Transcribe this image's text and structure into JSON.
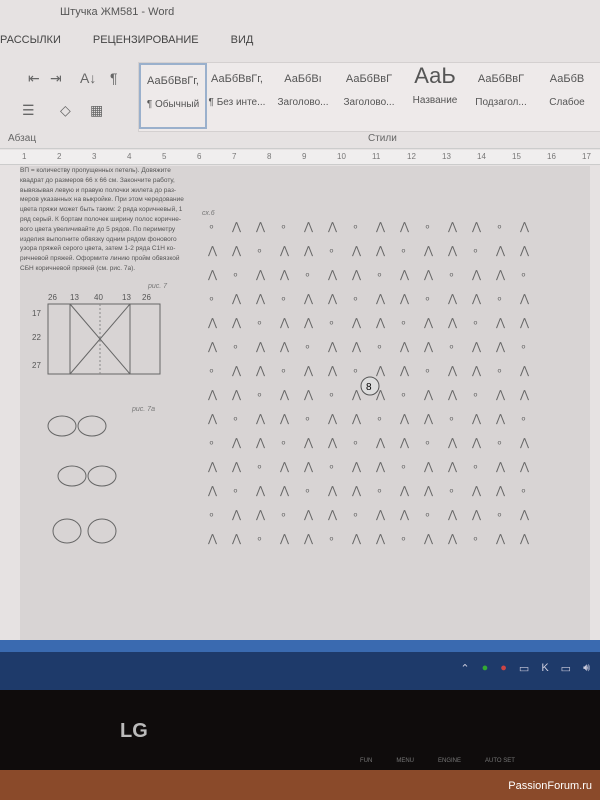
{
  "window": {
    "title": "Штучка ЖМ581 - Word"
  },
  "menu": [
    "РАССЫЛКИ",
    "РЕЦЕНЗИРОВАНИЕ",
    "ВИД"
  ],
  "styles": [
    {
      "sample": "АаБбВвГг,",
      "name": "¶ Обычный"
    },
    {
      "sample": "АаБбВвГг,",
      "name": "¶ Без инте..."
    },
    {
      "sample": "АаБбВı",
      "name": "Заголово..."
    },
    {
      "sample": "АаБбВвГ",
      "name": "Заголово..."
    },
    {
      "sample": "АаЬ",
      "name": "Название"
    },
    {
      "sample": "АаБбВвГ",
      "name": "Подзагол..."
    },
    {
      "sample": "АаБбВ",
      "name": "Слабое"
    }
  ],
  "groups": {
    "paragraph": "Абзац",
    "styles": "Стили"
  },
  "ruler": [
    "1",
    "2",
    "3",
    "4",
    "5",
    "6",
    "7",
    "8",
    "9",
    "10",
    "11",
    "12",
    "13",
    "14",
    "15",
    "16",
    "17"
  ],
  "document": {
    "paragraph": [
      "ВП = количеству пропущенных петель). Довяжите",
      "квадрат до размеров 66 х 66 см. Закончите работу,",
      "вывязывая левую и правую полочки жилета до раз-",
      "меров указанных на выкройке. При этом чередование",
      "цвета пряжи может быть таким: 2 ряда коричневый, 1",
      "ряд серый. К бортам полочек ширину полос коричне-",
      "вого цвета увеличивайте до 5 рядов. По периметру",
      "изделия выполните обвязку одним рядом фонового",
      "узора пряжей серого цвета, затем 1-2 ряда С1Н ко-",
      "ричневой пряжей. Оформите линию пройм обвязкой",
      "СБН коричневой пряжей (см. рис. 7а)."
    ],
    "fig7": "рис. 7",
    "fig7a": "рис. 7а",
    "chart_label": "сх.6",
    "center_number": "8",
    "dims_top": [
      "26",
      "13",
      "40",
      "13",
      "26"
    ],
    "dims_left": [
      "17",
      "22",
      "27"
    ]
  },
  "taskbar": {
    "tray_icons": [
      "chevron-up-icon",
      "android-icon",
      "record-icon",
      "keyboard-icon",
      "k-icon",
      "network-icon",
      "volume-icon"
    ]
  },
  "monitor": {
    "brand": "LG",
    "buttons": [
      "FUN",
      "MENU",
      "ENGINE",
      "AUTO SET"
    ]
  },
  "watermark": "PassionForum.ru"
}
